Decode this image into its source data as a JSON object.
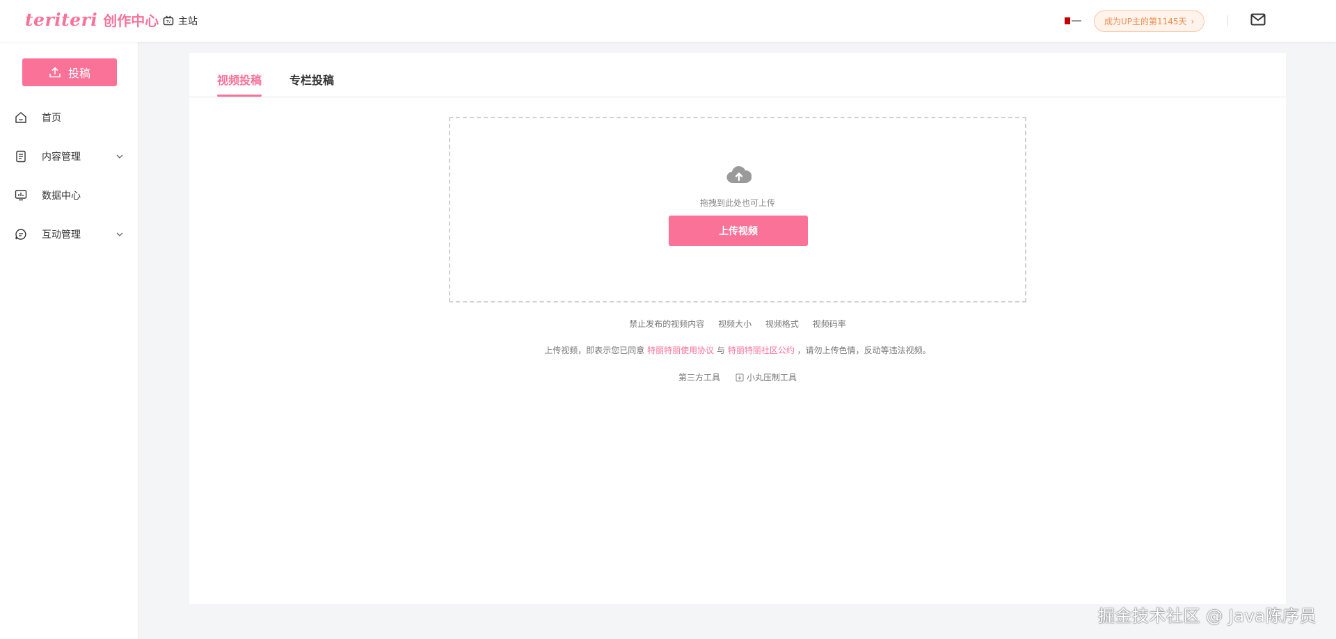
{
  "header": {
    "logo_script": "teriteri",
    "logo_text": "创作中心",
    "main_site_label": "主站",
    "up_badge": "成为UP主的第1145天",
    "icons": {
      "main_site": "tv-icon",
      "mail": "mail-icon",
      "badge_arrow": "chevron-right-icon"
    }
  },
  "sidebar": {
    "upload_label": "投稿",
    "items": [
      {
        "label": "首页",
        "icon": "home-icon",
        "expandable": false
      },
      {
        "label": "内容管理",
        "icon": "document-icon",
        "expandable": true
      },
      {
        "label": "数据中心",
        "icon": "chart-monitor-icon",
        "expandable": false
      },
      {
        "label": "互动管理",
        "icon": "chat-icon",
        "expandable": true
      }
    ]
  },
  "main": {
    "tabs": [
      {
        "label": "视频投稿",
        "active": true
      },
      {
        "label": "专栏投稿",
        "active": false
      }
    ],
    "drop_hint": "拖拽到此处也可上传",
    "upload_button": "上传视频",
    "links": [
      "禁止发布的视频内容",
      "视频大小",
      "视频格式",
      "视频码率"
    ],
    "agreement": {
      "prefix": "上传视频，即表示您已同意",
      "link1": "特丽特丽使用协议",
      "mid": "与",
      "link2": "特丽特丽社区公约",
      "suffix": "，请勿上传色情，反动等违法视频。"
    },
    "tools": [
      "第三方工具",
      "小丸压制工具"
    ]
  },
  "watermark": "掘金技术社区 @ Java陈序员",
  "colors": {
    "accent": "#fb7299",
    "badge_text": "#f08a4b",
    "badge_bg": "#fff4ec"
  }
}
